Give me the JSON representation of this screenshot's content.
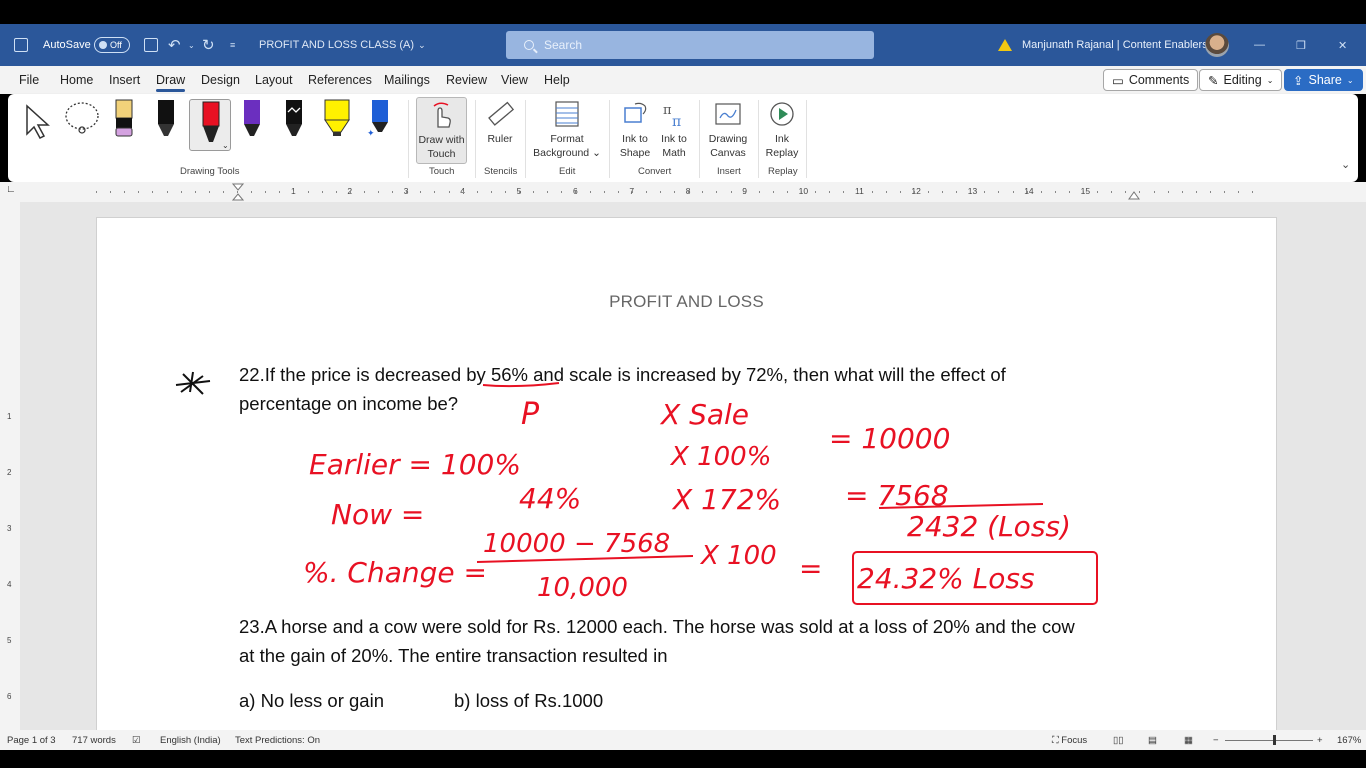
{
  "titlebar": {
    "autosave_label": "AutoSave",
    "autosave_state": "Off",
    "doc_title": "PROFIT AND LOSS CLASS (A)",
    "search_placeholder": "Search",
    "user_name": "Manjunath Rajanal | Content Enablers"
  },
  "menu": {
    "tabs": [
      "File",
      "Home",
      "Insert",
      "Draw",
      "Design",
      "Layout",
      "References",
      "Mailings",
      "Review",
      "View",
      "Help"
    ],
    "active_tab": "Draw",
    "comments_label": "Comments",
    "editing_label": "Editing",
    "share_label": "Share"
  },
  "ribbon": {
    "groups": {
      "drawing_tools": "Drawing Tools",
      "touch": "Touch",
      "stencils": "Stencils",
      "edit": "Edit",
      "convert": "Convert",
      "insert": "Insert",
      "replay": "Replay"
    },
    "buttons": {
      "draw_with_touch": [
        "Draw with",
        "Touch"
      ],
      "ruler": "Ruler",
      "format_background": [
        "Format",
        "Background"
      ],
      "ink_to_shape": [
        "Ink to",
        "Shape"
      ],
      "ink_to_math": [
        "Ink to",
        "Math"
      ],
      "drawing_canvas": [
        "Drawing",
        "Canvas"
      ],
      "ink_replay": [
        "Ink",
        "Replay"
      ]
    },
    "pen_colors": [
      "#f2d27a",
      "#000000",
      "#e81123",
      "#6b2fbf",
      "#000000",
      "#fff100",
      "#1f5fd6"
    ]
  },
  "ruler_numbers": [
    "1",
    "2",
    "3",
    "4",
    "5",
    "6",
    "7",
    "8",
    "9",
    "10",
    "11",
    "12",
    "13",
    "14",
    "15"
  ],
  "vruler_numbers": [
    "1",
    "2",
    "3",
    "4",
    "5",
    "6"
  ],
  "document": {
    "title": "PROFIT AND LOSS",
    "q22_line1": "22.If the price is decreased by 56% and scale is increased by 72%, then what will the effect of",
    "q22_line2": "percentage on income be?",
    "q23_line1": "23.A horse and a cow were sold for Rs. 12000 each. The horse was sold at a loss of 20% and the cow",
    "q23_line2": "at the gain of 20%. The entire transaction resulted in",
    "option_a": "a) No less or gain",
    "option_b": "b) loss of Rs.1000"
  },
  "ink_notes": {
    "p": "P",
    "x_sale": "X  Sale",
    "earlier": "Earlier  =  100%",
    "x100": "X  100%",
    "eq10000": "=  10000",
    "now": "Now  =",
    "n44": "44%",
    "x172": "X  172%",
    "eq7568": "=  7568",
    "n2432": "2432 (Loss)",
    "change": "%. Change =",
    "numerator": "10000 − 7568",
    "denominator": "10,000",
    "x100b": "X 100",
    "eq": "=",
    "result": "24.32% Loss",
    "color": "#e81123"
  },
  "status": {
    "page": "Page 1 of 3",
    "words": "717 words",
    "language": "English (India)",
    "predictions": "Text Predictions: On",
    "focus": "Focus",
    "zoom": "167%"
  }
}
